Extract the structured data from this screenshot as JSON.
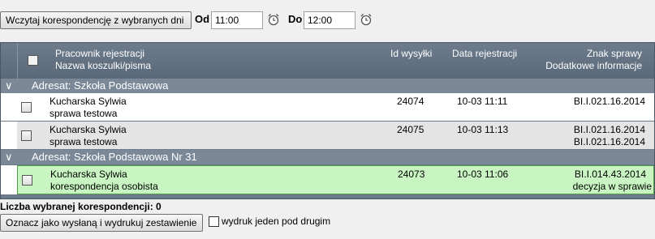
{
  "toolbar": {
    "load_button": "Wczytaj korespondencję z wybranych dni",
    "from_label": "Od",
    "from_value": "11:00",
    "to_label": "Do",
    "to_value": "12:00"
  },
  "grid": {
    "headers": {
      "worker": "Pracownik rejestracji",
      "name": "Nazwa koszulki/pisma",
      "send_id": "Id wysyłki",
      "reg_date": "Data rejestracji",
      "case_sign": "Znak sprawy",
      "extra_info": "Dodatkowe informacje"
    },
    "groups": [
      {
        "title": "Adresat: Szkoła Podstawowa",
        "rows": [
          {
            "worker": "Kucharska Sylwia",
            "name": "sprawa testowa",
            "send_id": "24074",
            "reg_date": "10-03 11:11",
            "case_sign": "BI.I.021.16.2014",
            "extra_info": ""
          },
          {
            "worker": "Kucharska Sylwia",
            "name": "sprawa testowa",
            "send_id": "24075",
            "reg_date": "10-03 11:13",
            "case_sign": "BI.I.021.16.2014",
            "extra_info": "BI.I.021.16.2014"
          }
        ]
      },
      {
        "title": "Adresat: Szkoła Podstawowa Nr 31",
        "rows": [
          {
            "worker": "Kucharska Sylwia",
            "name": "korespondencja osobista",
            "send_id": "24073",
            "reg_date": "10-03 11:06",
            "case_sign": "BI.I.014.43.2014",
            "extra_info": "decyzja w sprawie"
          }
        ]
      }
    ]
  },
  "footer": {
    "count_label": "Liczba wybranej korespondencji: 0",
    "mark_button": "Oznacz jako wysłaną i wydrukuj zestawienie",
    "print_option": "wydruk jeden pod drugim"
  },
  "colors": {
    "header": "#6b7b8c",
    "group": "#7a8898",
    "selected_row": "#c9f5c2"
  },
  "icons": {
    "time_picker": "alarm-clock-icon",
    "expand": "chevron-down-icon"
  }
}
